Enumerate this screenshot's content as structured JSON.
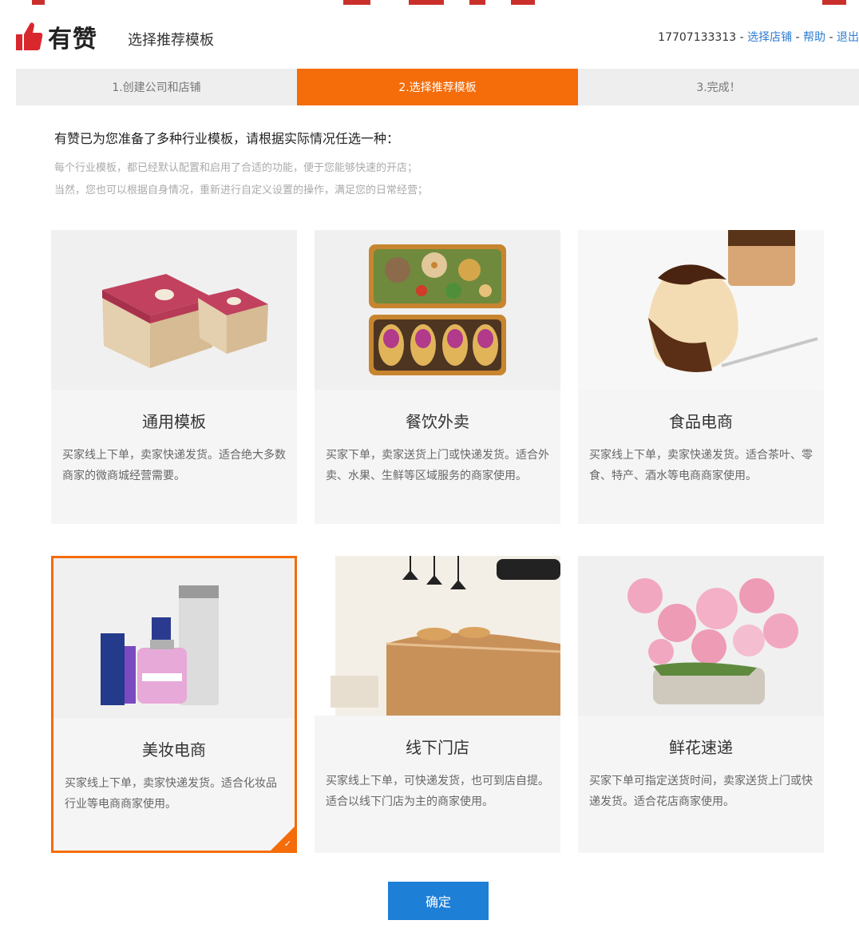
{
  "header": {
    "logo_text": "有赞",
    "page_title": "选择推荐模板",
    "phone": "17707133313",
    "sep1": " - ",
    "select_store": "选择店铺",
    "sep2": " - ",
    "help": "帮助",
    "sep3": " - ",
    "logout": "退出"
  },
  "steps": [
    {
      "label": "1.创建公司和店铺"
    },
    {
      "label": "2.选择推荐模板"
    },
    {
      "label": "3.完成！"
    }
  ],
  "intro": {
    "heading": "有赞已为您准备了多种行业模板，请根据实际情况任选一种：",
    "line1": "每个行业模板，都已经默认配置和启用了合适的功能，便于您能够快速的开店；",
    "line2": "当然，您也可以根据自身情况，重新进行自定义设置的操作，满足您的日常经营；"
  },
  "templates": [
    {
      "title": "通用模板",
      "desc": "买家线上下单，卖家快递发货。适合绝大多数商家的微商城经营需要。"
    },
    {
      "title": "餐饮外卖",
      "desc": "买家下单，卖家送货上门或快递发货。适合外卖、水果、生鲜等区域服务的商家使用。"
    },
    {
      "title": "食品电商",
      "desc": "买家线上下单，卖家快递发货。适合茶叶、零食、特产、酒水等电商商家使用。"
    },
    {
      "title": "美妆电商",
      "desc": "买家线上下单，卖家快递发货。适合化妆品行业等电商商家使用。",
      "selected": true
    },
    {
      "title": "线下门店",
      "desc": "买家线上下单，可快递发货，也可到店自提。适合以线下门店为主的商家使用。"
    },
    {
      "title": "鲜花速递",
      "desc": "买家下单可指定送货时间，卖家送货上门或快递发货。适合花店商家使用。"
    }
  ],
  "confirm_label": "确定",
  "colors": {
    "accent": "#f56c0a",
    "primary": "#1e7fd6",
    "link": "#2e7dd2",
    "thumb": "#d9272e"
  }
}
